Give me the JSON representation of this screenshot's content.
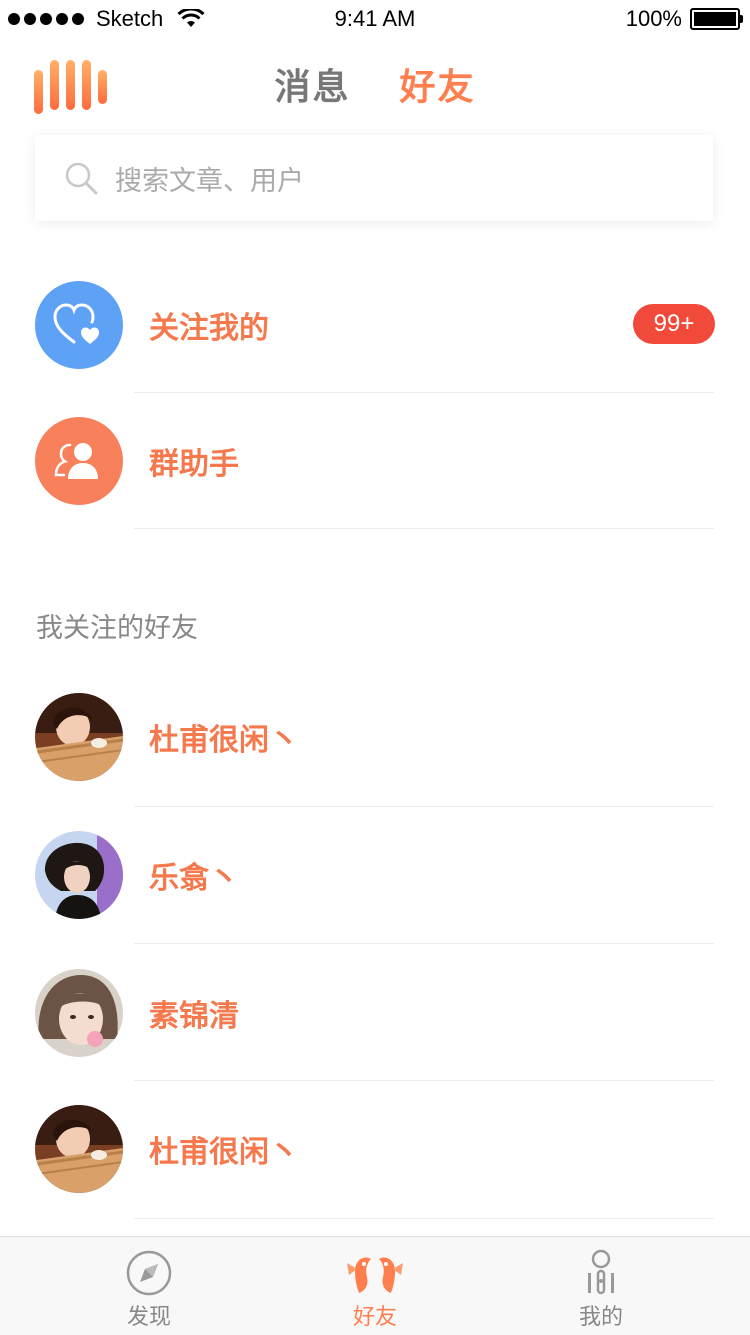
{
  "status_bar": {
    "carrier": "Sketch",
    "time": "9:41 AM",
    "battery": "100%"
  },
  "header": {
    "tabs": [
      {
        "label": "消息",
        "active": false
      },
      {
        "label": "好友",
        "active": true
      }
    ]
  },
  "search": {
    "placeholder": "搜索文章、用户"
  },
  "special_rows": [
    {
      "label": "关注我的",
      "icon": "heart-icon",
      "icon_bg": "#5ea2f6",
      "badge": "99+"
    },
    {
      "label": "群助手",
      "icon": "group-user-icon",
      "icon_bg": "#f8815b"
    }
  ],
  "section_title": "我关注的好友",
  "friends": [
    {
      "name": "杜甫很闲丶"
    },
    {
      "name": "乐翕丶"
    },
    {
      "name": "素锦清"
    },
    {
      "name": "杜甫很闲丶"
    }
  ],
  "tab_bar": {
    "items": [
      {
        "label": "发现",
        "icon": "compass-icon",
        "active": false
      },
      {
        "label": "好友",
        "icon": "friends-icon",
        "active": true
      },
      {
        "label": "我的",
        "icon": "profile-icon",
        "active": false
      }
    ]
  },
  "colors": {
    "accent": "#ff7e4f",
    "badge": "#f24a3a",
    "heart_circle": "#5ea2f6",
    "group_circle": "#f8815b"
  }
}
